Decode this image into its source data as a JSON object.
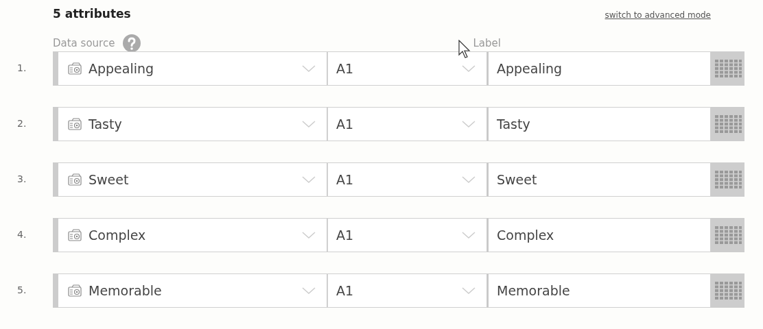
{
  "title": "5 attributes",
  "mode_link": "switch to advanced mode",
  "columns": {
    "source": "Data source",
    "label": "Label"
  },
  "rows": [
    {
      "number": "1.",
      "source": "Appealing",
      "level": "A1",
      "label": "Appealing"
    },
    {
      "number": "2.",
      "source": "Tasty",
      "level": "A1",
      "label": "Tasty"
    },
    {
      "number": "3.",
      "source": "Sweet",
      "level": "A1",
      "label": "Sweet"
    },
    {
      "number": "4.",
      "source": "Complex",
      "level": "A1",
      "label": "Complex"
    },
    {
      "number": "5.",
      "source": "Memorable",
      "level": "A1",
      "label": "Memorable"
    }
  ]
}
